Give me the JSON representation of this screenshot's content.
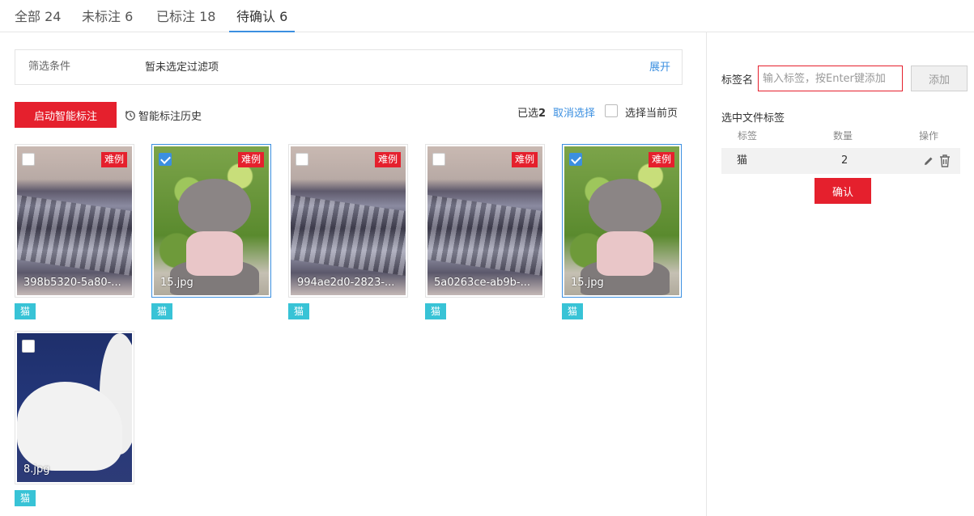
{
  "tabs": [
    {
      "label": "全部 24"
    },
    {
      "label": "未标注 6"
    },
    {
      "label": "已标注 18"
    },
    {
      "label": "待确认 6",
      "active": true
    }
  ],
  "filter": {
    "label": "筛选条件",
    "value": "暂未选定过滤项",
    "expand": "展开"
  },
  "toolbar": {
    "smart_label_button": "启动智能标注",
    "history": "智能标注历史",
    "selected_prefix": "已选",
    "selected_count": "2",
    "cancel_selection": "取消选择",
    "select_page": "选择当前页"
  },
  "cards": [
    {
      "filename": "398b5320-5a80-...",
      "badge": "难例",
      "tag": "猫",
      "checked": false,
      "image": "keyboard"
    },
    {
      "filename": "15.jpg",
      "badge": "难例",
      "tag": "猫",
      "checked": true,
      "image": "dog"
    },
    {
      "filename": "994ae2d0-2823-...",
      "badge": "难例",
      "tag": "猫",
      "checked": false,
      "image": "keyboard"
    },
    {
      "filename": "5a0263ce-ab9b-...",
      "badge": "难例",
      "tag": "猫",
      "checked": false,
      "image": "keyboard"
    },
    {
      "filename": "15.jpg",
      "badge": "难例",
      "tag": "猫",
      "checked": true,
      "image": "dog"
    },
    {
      "filename": "8.jpg",
      "badge": "",
      "tag": "猫",
      "checked": false,
      "image": "cat"
    }
  ],
  "panel": {
    "label_name": "标签名",
    "input_placeholder": "输入标签，按Enter键添加",
    "add_button": "添加",
    "subtitle": "选中文件标签",
    "headers": {
      "tag": "标签",
      "count": "数量",
      "action": "操作"
    },
    "rows": [
      {
        "tag": "猫",
        "count": "2"
      }
    ],
    "confirm_button": "确认"
  },
  "colors": {
    "accent": "#3b8fe0",
    "brand_red": "#e5202d",
    "tag_cyan": "#38c3d6"
  }
}
